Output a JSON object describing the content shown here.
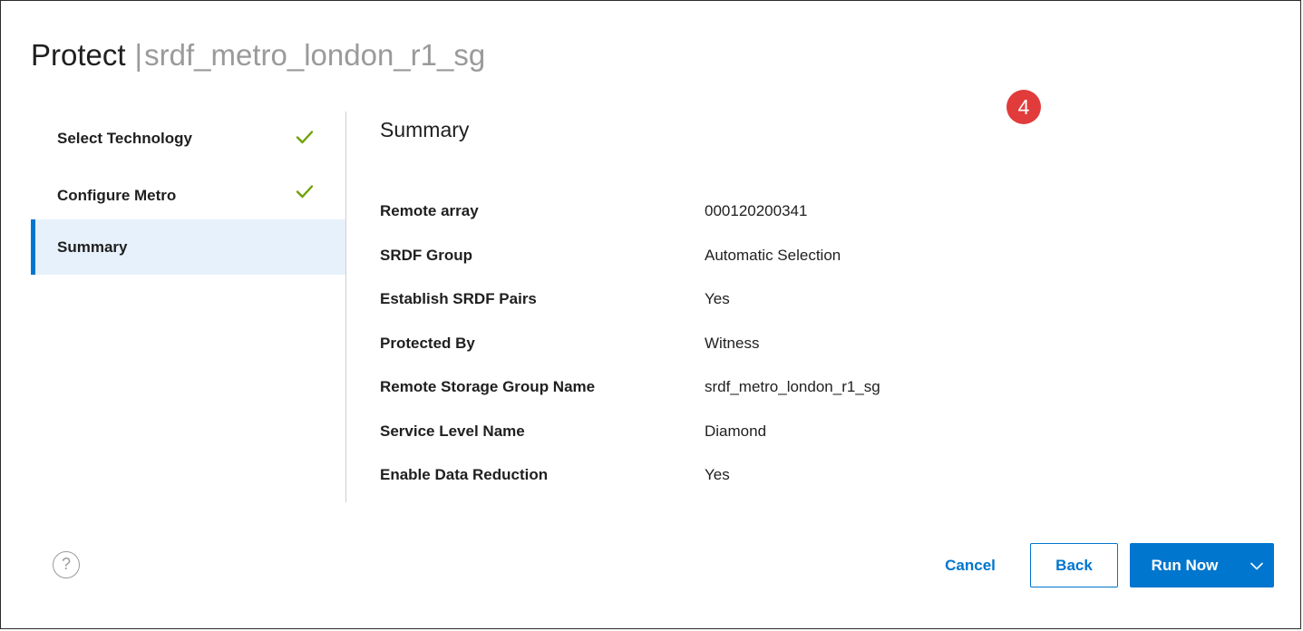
{
  "header": {
    "title": "Protect",
    "separator": "|",
    "subtitle": "srdf_metro_london_r1_sg"
  },
  "step_marker": "4",
  "steps": [
    {
      "label": "Select Technology",
      "status": "complete",
      "icon": "check-icon"
    },
    {
      "label": "Configure Metro",
      "status": "complete",
      "icon": "check-icon"
    },
    {
      "label": "Summary",
      "status": "active"
    }
  ],
  "section_title": "Summary",
  "summary_rows": [
    {
      "label": "Remote array",
      "value": "000120200341"
    },
    {
      "label": "SRDF Group",
      "value": "Automatic Selection"
    },
    {
      "label": "Establish SRDF Pairs",
      "value": "Yes"
    },
    {
      "label": "Protected By",
      "value": "Witness"
    },
    {
      "label": "Remote Storage Group Name",
      "value": "srdf_metro_london_r1_sg"
    },
    {
      "label": "Service Level Name",
      "value": "Diamond"
    },
    {
      "label": "Enable Data Reduction",
      "value": "Yes"
    }
  ],
  "footer": {
    "help_icon": "question-circle-icon",
    "help_glyph": "?",
    "cancel_label": "Cancel",
    "back_label": "Back",
    "run_label": "Run Now",
    "run_menu_icon": "chevron-down-icon"
  },
  "colors": {
    "accent": "#0076ce",
    "active_step_bg": "#e7f1fb",
    "check": "#6ea204",
    "marker": "#e13b3b",
    "muted_text": "#9a9a9a"
  }
}
